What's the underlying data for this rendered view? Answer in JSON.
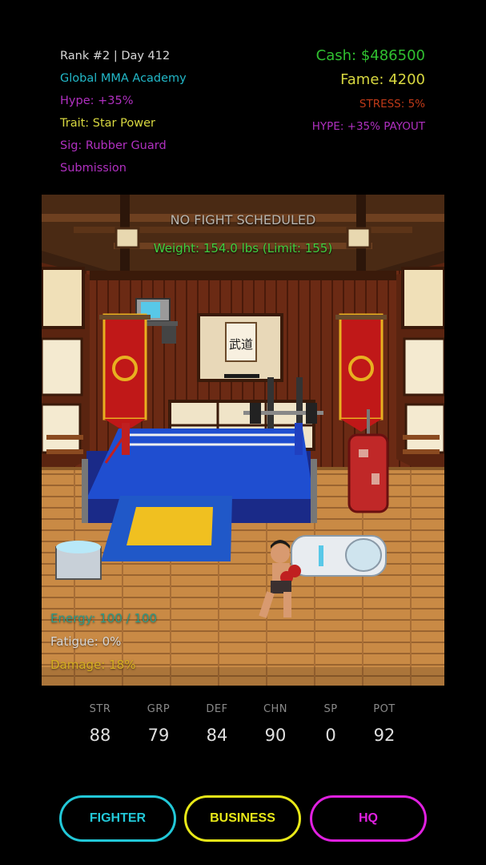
{
  "hud": {
    "rank": "Rank #2 | Day 412",
    "academy": "Global MMA Academy",
    "hype": "Hype: +35%",
    "trait": "Trait: Star Power",
    "sig_line1": "Sig: Rubber Guard",
    "sig_line2": "Submission",
    "cash": "Cash: $486500",
    "fame": "Fame: 4200",
    "stress": "STRESS: 5%",
    "hype_payout": "HYPE: +35% PAYOUT"
  },
  "scene": {
    "fight_status": "NO FIGHT SCHEDULED",
    "weight": "Weight: 154.0 lbs (Limit: 155)",
    "scroll_text": "武道",
    "energy": "Energy: 100 / 100",
    "fatigue": "Fatigue: 0%",
    "damage": "Damage: 18%"
  },
  "stats": [
    {
      "label": "STR",
      "value": "88"
    },
    {
      "label": "GRP",
      "value": "79"
    },
    {
      "label": "DEF",
      "value": "84"
    },
    {
      "label": "CHN",
      "value": "90"
    },
    {
      "label": "SP",
      "value": "0"
    },
    {
      "label": "POT",
      "value": "92"
    }
  ],
  "buttons": {
    "fighter": "FIGHTER",
    "business": "BUSINESS",
    "hq": "HQ"
  },
  "colors": {
    "background": "#000000",
    "rank": "#d8d8d8",
    "academy": "#22b8c8",
    "hype": "#b030c0",
    "trait": "#d8d840",
    "sig": "#b030c0",
    "cash": "#30c030",
    "fame": "#d8d840",
    "stress": "#c03a18",
    "hype_payout": "#b030c0",
    "energy": "#2c9a88",
    "fatigue": "#d8d8d8",
    "damage": "#d8b020",
    "fighter_button": "#22c8d8",
    "business_button": "#e8e818",
    "hq_button": "#e020e0"
  },
  "icons": [
    "crt-tv-icon",
    "banner-phoenix-icon",
    "punching-bag-icon",
    "ice-bath-icon",
    "cryo-pod-icon",
    "barbell-rack-icon",
    "boxing-ring-icon",
    "fighter-sprite-icon"
  ]
}
